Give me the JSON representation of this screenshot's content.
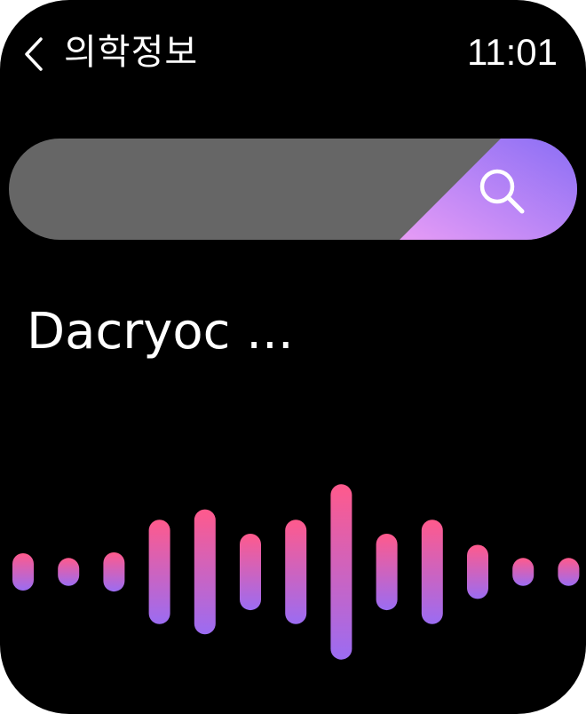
{
  "header": {
    "back_icon": "chevron-left-icon",
    "title": "의학정보",
    "time": "11:01"
  },
  "search": {
    "value": "",
    "placeholder": "",
    "button_icon": "search-icon"
  },
  "result": {
    "text": "Dacryoc ..."
  },
  "voice_wave": {
    "icon": "audio-waveform",
    "bar_levels": [
      0.2,
      0.15,
      0.21,
      0.56,
      0.67,
      0.41,
      0.56,
      0.94,
      0.41,
      0.56,
      0.29,
      0.15,
      0.15
    ],
    "colors": {
      "top": "#ff5a8c",
      "bottom": "#9b6cf2"
    }
  },
  "colors": {
    "background": "#000000",
    "search_field": "#666666",
    "search_accent_start": "#e79cf6",
    "search_accent_end": "#8a6ef5"
  }
}
